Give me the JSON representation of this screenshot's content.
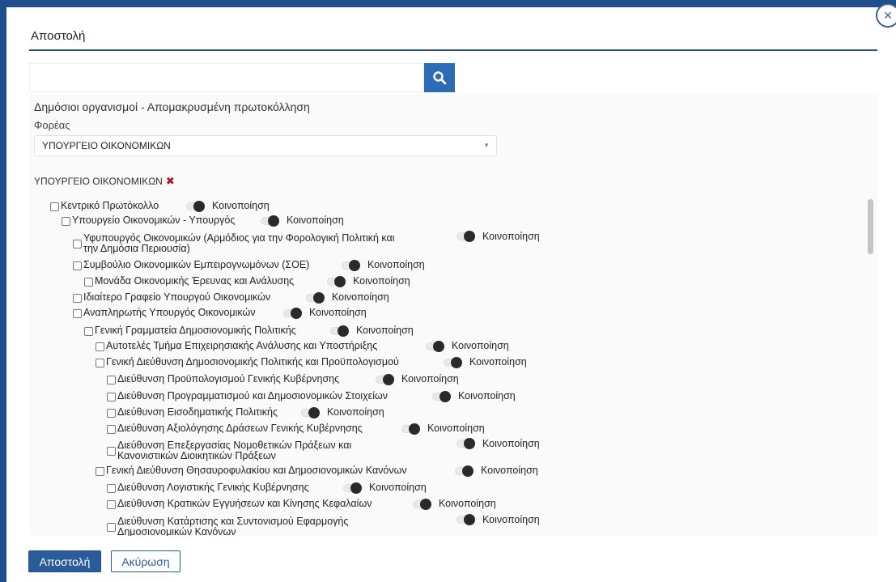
{
  "modal": {
    "title": "Αποστολή"
  },
  "search": {
    "value": "",
    "placeholder": ""
  },
  "section": {
    "title": "Δημόσιοι οργανισμοί - Απομακρυσμένη πρωτοκόλληση",
    "field_label": "Φορέας",
    "selected_value": "ΥΠΟΥΡΓΕΙΟ ΟΙΚΟΝΟΜΙΚΩΝ",
    "chip_label": "ΥΠΟΥΡΓΕΙΟ ΟΙΚΟΝΟΜΙΚΩΝ"
  },
  "share_label": "Κοινοποίηση",
  "tree": [
    {
      "line1": "Κεντρικό Πρωτόκολλο",
      "line2": ""
    },
    {
      "line1": "Υπουργείο Οικονομικών - Υπουργός",
      "line2": ""
    },
    {
      "line1": "Υφυπουργός Οικονομικών (Αρμόδιος για την Φορολογική Πολιτική και",
      "line2": "την Δημόσια Περιουσία)"
    },
    {
      "line1": "Συμβούλιο Οικονομικών Εμπειρογνωμόνων (ΣΟΕ)",
      "line2": ""
    },
    {
      "line1": "Μονάδα Οικονομικής Έρευνας και Ανάλυσης",
      "line2": ""
    },
    {
      "line1": "Ιδιαίτερο Γραφείο Υπουργού Οικονομικών",
      "line2": ""
    },
    {
      "line1": "Αναπληρωτής Υπουργός Οικονομικών",
      "line2": ""
    },
    {
      "line1": "Γενική Γραμματεία Δημοσιονομικής Πολιτικής",
      "line2": ""
    },
    {
      "line1": "Αυτοτελές Τμήμα Επιχειρησιακής Ανάλυσης και Υποστήριξης",
      "line2": ""
    },
    {
      "line1": "Γενική Διεύθυνση Δημοσιονομικής Πολιτικής και Προϋπολογισμού",
      "line2": ""
    },
    {
      "line1": "Διεύθυνση Προϋπολογισμού Γενικής Κυβέρνησης",
      "line2": ""
    },
    {
      "line1": "Διεύθυνση Προγραμματισμού και Δημοσιονομικών Στοιχείων",
      "line2": ""
    },
    {
      "line1": "Διεύθυνση Εισοδηματικής Πολιτικής",
      "line2": ""
    },
    {
      "line1": "Διεύθυνση Αξιολόγησης Δράσεων Γενικής Κυβέρνησης",
      "line2": ""
    },
    {
      "line1": "Διεύθυνση Επεξεργασίας Νομοθετικών Πράξεων και",
      "line2": "Κανονιστικών Διοικητικών Πράξεων"
    },
    {
      "line1": "Γενική Διεύθυνση Θησαυροφυλακίου και Δημοσιονομικών Κανόνων",
      "line2": ""
    },
    {
      "line1": "Διεύθυνση Λογιστικής Γενικής Κυβέρνησης",
      "line2": ""
    },
    {
      "line1": "Διεύθυνση Κρατικών Εγγυήσεων και Κίνησης Κεφαλαίων",
      "line2": ""
    },
    {
      "line1": "Διεύθυνση Κατάρτισης και Συντονισμού Εφαρμογής",
      "line2": "Δημοσιονομικών Κανόνων"
    }
  ],
  "buttons": {
    "send": "Αποστολή",
    "cancel": "Ακύρωση"
  },
  "icons": {
    "search": "search-icon",
    "close": "close-icon",
    "remove": "remove-icon"
  },
  "colors": {
    "primary": "#2a5b9b",
    "remove": "#b0141e"
  }
}
